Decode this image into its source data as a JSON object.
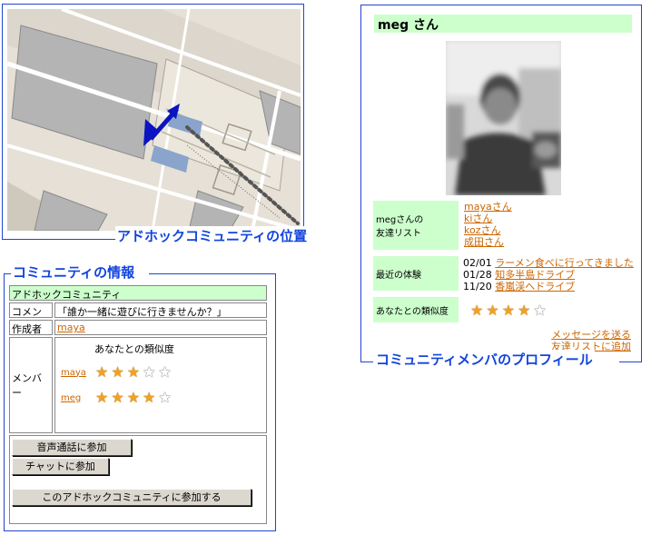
{
  "map": {
    "caption": "アドホックコミュニティの位置"
  },
  "community": {
    "section_title": "コミュニティの情報",
    "name": "アドホックコミュニティ",
    "comment_label": "コメント",
    "comment_value": "「誰か一緒に遊びに行きませんか？」",
    "author_label": "作成者",
    "author_value": "maya",
    "members_label": "メンバー",
    "similarity_header": "あなたとの類似度",
    "members": [
      {
        "name": "maya",
        "stars": 3,
        "max": 5
      },
      {
        "name": "meg",
        "stars": 4,
        "max": 5
      }
    ],
    "buttons": {
      "voice_label": "音声通話に参加",
      "chat_label": "チャットに参加",
      "join_label": "このアドホックコミュニティに参加する"
    }
  },
  "profile": {
    "name_title": "meg さん",
    "friends_label_line1": "megさんの",
    "friends_label_line2": "友達リスト",
    "friends": [
      "mayaさん",
      "kiさん",
      "kozさん",
      "成田さん"
    ],
    "recent_label": "最近の体験",
    "recent": [
      {
        "date": "02/01",
        "text": "ラーメン食べに行ってきました"
      },
      {
        "date": "01/28",
        "text": "知多半島ドライブ"
      },
      {
        "date": "11/20",
        "text": "香嵐渓へドライブ"
      }
    ],
    "similarity_label": "あなたとの類似度",
    "similarity_stars": 4,
    "similarity_max": 5,
    "send_message_link": "メッセージを送る",
    "add_friend_link": "友達リストに追加",
    "section_caption": "コミュニティメンバのプロフィール"
  },
  "colors": {
    "frame_blue": "#2244cc",
    "caption_blue": "#1144dd",
    "label_green": "#ccffcc",
    "link_orange": "#cc6600"
  }
}
